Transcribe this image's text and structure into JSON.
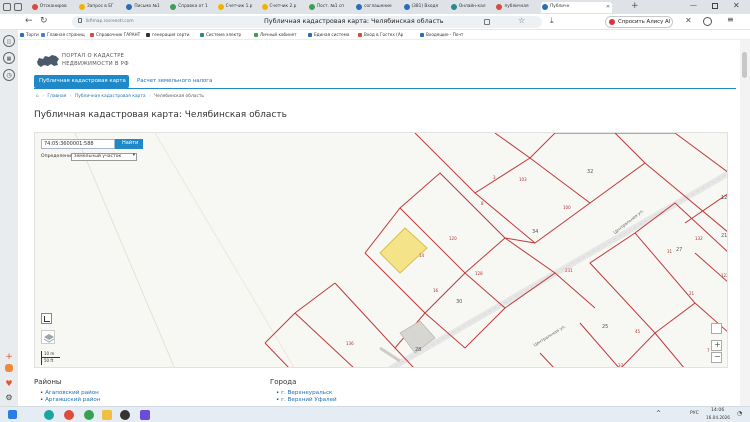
{
  "tabs": [
    {
      "title": "Отсканиров",
      "color": "#d94b3a"
    },
    {
      "title": "Запрос в ЕГ",
      "color": "#f0b400"
    },
    {
      "title": "Письмо №1",
      "color": "#2a6db8"
    },
    {
      "title": "Справка от 1",
      "color": "#3aa055"
    },
    {
      "title": "Счетчик 1.р",
      "color": "#f0b400"
    },
    {
      "title": "Счетчик 2.р",
      "color": "#f0b400"
    },
    {
      "title": "Пост. №1 сп",
      "color": "#3aa055"
    },
    {
      "title": "соглашение",
      "color": "#2a6db8"
    },
    {
      "title": "(381) Входя",
      "color": "#2a6db8"
    },
    {
      "title": "Онлайн-кал",
      "color": "#2a8a8a"
    },
    {
      "title": "публичная",
      "color": "#d94b3a"
    },
    {
      "title": "Публичн",
      "color": "#2a6db8"
    }
  ],
  "address": {
    "url": "lkfimap.rosreestr.com",
    "page_title": "Публичная кадастровая карта: Челябинская область",
    "alice_label": "Спросить Алису AI"
  },
  "bookmarks": [
    {
      "label": "Торги",
      "color": "#2a6db8"
    },
    {
      "label": "Главная страниц",
      "color": "#4d7fc8"
    },
    {
      "label": "Справочник ГАРАНТ",
      "color": "#d94b3a"
    },
    {
      "label": "генерация серти",
      "color": "#333333"
    },
    {
      "label": "Система электр",
      "color": "#2a8a8a"
    },
    {
      "label": "Личный кабинет",
      "color": "#3aa055"
    },
    {
      "label": "Единая система",
      "color": "#2a6db8"
    },
    {
      "label": "Вход в Гостех (Ар",
      "color": "#d94b3a"
    },
    {
      "label": "Входящие - Почт",
      "color": "#2a6db8"
    }
  ],
  "logo": {
    "line1": "ПОРТАЛ О КАДАСТРЕ",
    "line2": "НЕДВИЖИМОСТИ В РФ"
  },
  "nav": {
    "active_tab": "Публичная кадастровая карта",
    "other_tab": "Расчет земельного налога"
  },
  "breadcrumb": {
    "home": "Главная",
    "map": "Публичная кадастровая карта",
    "region": "Челябинская область"
  },
  "heading": "Публичная кадастровая карта: Челябинская область",
  "search": {
    "value": "74:05:3600001:588",
    "button": "Найти",
    "mode_label": "Определение",
    "mode_value": "земельный участок"
  },
  "scale": {
    "top": "10 m",
    "bottom": "50 ft"
  },
  "zoom": {
    "plus": "+",
    "minus": "−"
  },
  "map_labels": {
    "l32": "32",
    "l3": "3",
    "l103": "103",
    "l100": "100",
    "l125": "125",
    "l34": "34",
    "l8": "8",
    "l120": "120",
    "l14": "14",
    "l128": "128",
    "l16": "16",
    "l30": "30",
    "l231": "231",
    "l21": "21",
    "l27": "27",
    "l31": "31",
    "l132": "132",
    "l122": "122",
    "l21b": "21",
    "l25": "25",
    "l45": "45",
    "l7": "7",
    "l136": "136",
    "l28": "28",
    "l37": "37",
    "street1": "Центральная ул.",
    "street2": "Центральная ул."
  },
  "sections": {
    "regions_title": "Районы",
    "regions": [
      "Агаповский район",
      "Аргаяшский район"
    ],
    "cities_title": "Города",
    "cities": [
      "г. Верхнеуральск",
      "г. Верхний Уфалей"
    ]
  },
  "taskbar": {
    "lang": "РУС",
    "time": "14:06",
    "date": "16.04.2026"
  }
}
